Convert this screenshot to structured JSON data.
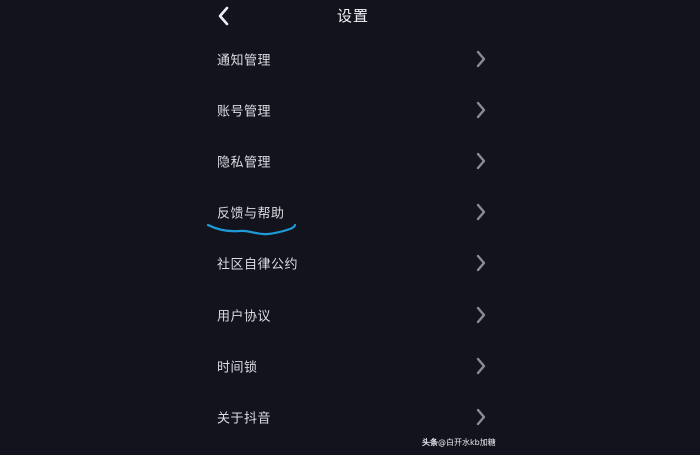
{
  "header": {
    "title": "设置",
    "back_icon": "chevron-left-icon"
  },
  "menu": {
    "items": [
      {
        "label": "通知管理",
        "icon": "chevron-right-icon"
      },
      {
        "label": "账号管理",
        "icon": "chevron-right-icon"
      },
      {
        "label": "隐私管理",
        "icon": "chevron-right-icon"
      },
      {
        "label": "反馈与帮助",
        "icon": "chevron-right-icon",
        "annotation": "hand-drawn blue underline"
      },
      {
        "label": "社区自律公约",
        "icon": "chevron-right-icon"
      },
      {
        "label": "用户协议",
        "icon": "chevron-right-icon"
      },
      {
        "label": "时间锁",
        "icon": "chevron-right-icon"
      },
      {
        "label": "关于抖音",
        "icon": "chevron-right-icon"
      }
    ]
  },
  "watermark": {
    "brand": "头条",
    "handle": "@白开水kb加糖"
  },
  "colors": {
    "background": "#12131d",
    "text": "#dcdce2",
    "chevron": "#8a8b93",
    "annotation_stroke": "#1e9ad6"
  }
}
